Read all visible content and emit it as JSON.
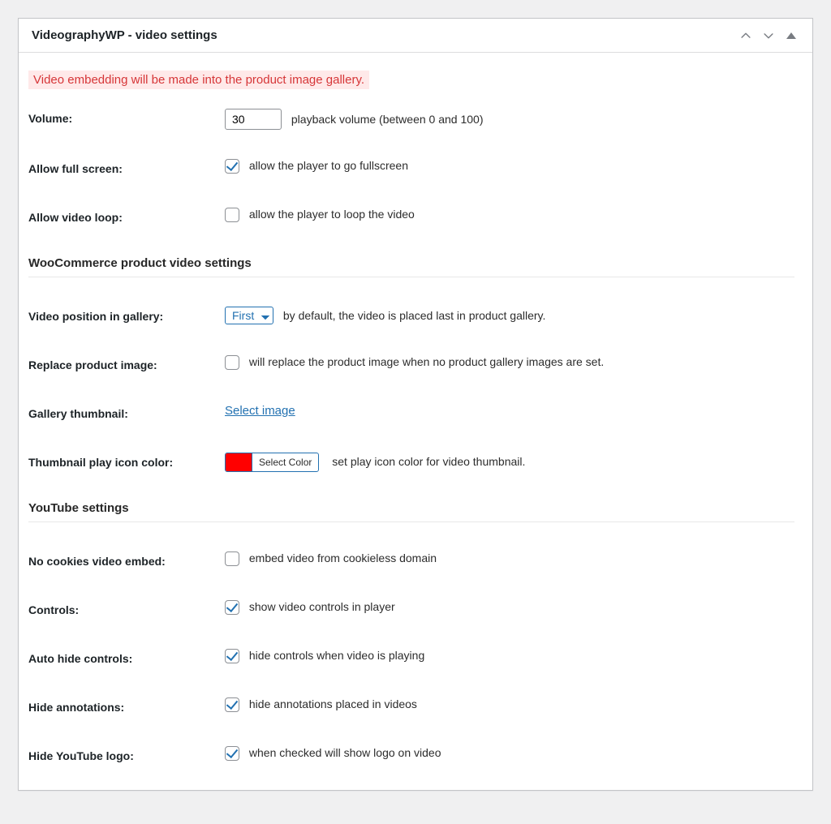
{
  "panel": {
    "title": "VideographyWP - video settings"
  },
  "notice": "Video embedding will be made into the product image gallery.",
  "rows": {
    "volume": {
      "label": "Volume:",
      "value": "30",
      "desc": "playback volume (between 0 and 100)"
    },
    "fullscreen": {
      "label": "Allow full screen:",
      "checked": true,
      "desc": "allow the player to go fullscreen"
    },
    "loop": {
      "label": "Allow video loop:",
      "checked": false,
      "desc": "allow the player to loop the video"
    },
    "wc_section": "WooCommerce product video settings",
    "position": {
      "label": "Video position in gallery:",
      "value": "First",
      "desc": "by default, the video is placed last in product gallery."
    },
    "replace": {
      "label": "Replace product image:",
      "checked": false,
      "desc": "will replace the product image when no product gallery images are set."
    },
    "thumb": {
      "label": "Gallery thumbnail:",
      "link": "Select image"
    },
    "icon_color": {
      "label": "Thumbnail play icon color:",
      "btn": "Select Color",
      "swatch": "#ff0000",
      "desc": "set play icon color for video thumbnail."
    },
    "yt_section": "YouTube settings",
    "nocookie": {
      "label": "No cookies video embed:",
      "checked": false,
      "desc": "embed video from cookieless domain"
    },
    "controls": {
      "label": "Controls:",
      "checked": true,
      "desc": "show video controls in player"
    },
    "autohide": {
      "label": "Auto hide controls:",
      "checked": true,
      "desc": "hide controls when video is playing"
    },
    "annotations": {
      "label": "Hide annotations:",
      "checked": true,
      "desc": "hide annotations placed in videos"
    },
    "hideyt": {
      "label": "Hide YouTube logo:",
      "checked": true,
      "desc": "when checked will show logo on video"
    }
  }
}
